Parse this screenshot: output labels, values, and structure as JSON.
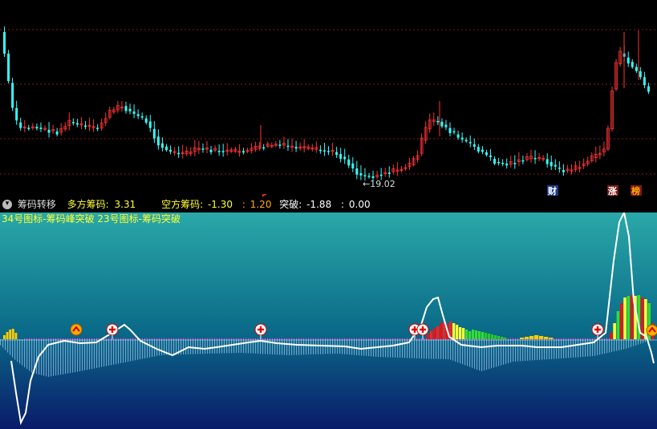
{
  "colors": {
    "up": "#ff3333",
    "down": "#33ffff",
    "grid": "#8a1a1a",
    "label": "#ffff33",
    "white": "#ffffff"
  },
  "price_panel": {
    "price_annotation": "←19.02",
    "markers": [
      {
        "text": "S",
        "color": "#ff3333"
      },
      {
        "text": "财",
        "color": "#ffffff",
        "bg": "#1a3a8a"
      },
      {
        "text": "涨",
        "color": "#ffffff",
        "bg": "#7a1a1a"
      },
      {
        "text": "榜",
        "color": "#ffaa00",
        "bg": "#7a1a1a"
      }
    ]
  },
  "info_bar": {
    "icon": "chevron-down-icon",
    "title": "筹码转移",
    "items": [
      {
        "label": "多方筹码:",
        "value": "3.31"
      },
      {
        "label": "空方筹码:",
        "value": "-1.30"
      },
      {
        "label": ":",
        "value": "1.20"
      },
      {
        "label": "突破:",
        "value": "-1.88"
      },
      {
        "label": ":",
        "value": "0.00"
      }
    ]
  },
  "indicator_panel": {
    "caption": "34号图标-筹码峰突破 23号图标-筹码突破",
    "icons": [
      "arrow-up-icon",
      "plus-circle-icon"
    ]
  },
  "chart_data": [
    {
      "type": "candlestick",
      "title": "",
      "annotations": [
        {
          "text": "←19.02",
          "note": "lowest price"
        }
      ],
      "series": [
        {
          "x_index_range": [
            0,
            160
          ],
          "price_low": 19.02
        }
      ],
      "grid": true
    },
    {
      "type": "bar",
      "title": "筹码转移",
      "series": [
        {
          "name": "多方筹码",
          "last": 3.31
        },
        {
          "name": "空方筹码",
          "last": -1.3
        },
        {
          "name": "",
          "last": 1.2
        },
        {
          "name": "突破",
          "last": -1.88
        },
        {
          "name": "",
          "last": 0.0
        }
      ]
    }
  ]
}
